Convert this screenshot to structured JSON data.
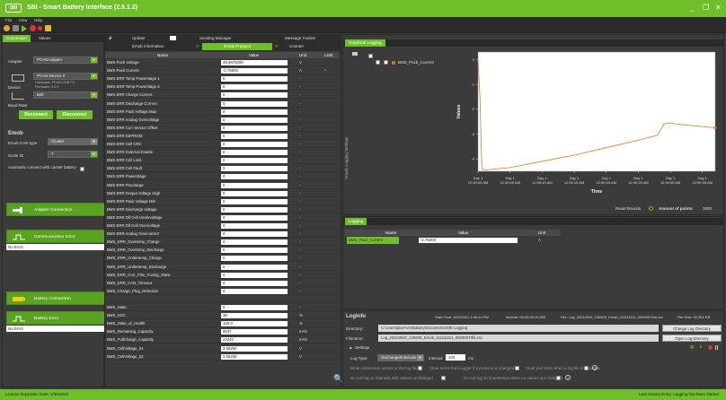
{
  "window": {
    "logo_text": "SBI",
    "title": "SBI - Smart Battery Interface (2.5.1.2)",
    "min": "_",
    "restore": "❐",
    "close": "✕"
  },
  "menu": [
    "File",
    "View",
    "Help"
  ],
  "left": {
    "tabs": [
      "Connection",
      "Values"
    ],
    "adapter_label": "Adapter",
    "adapter_value": "PCANAdapter",
    "device_label": "Device",
    "device_value": "PCAN Device 0",
    "hardware": "Hardware: PCAN-USB FD",
    "firmware": "Firmware: 3.2.0",
    "baud_label": "Baud Rate",
    "baud_value": "500",
    "reconnect": "Reconnect",
    "disconnect": "Disconnect",
    "emob_title": "Emob",
    "can_type_label": "Emob CAN type",
    "can_type_value": "Cluster",
    "scale_label": "Scale ID",
    "scale_value": "7",
    "auto_connect": "Automatic connect with cluster battery",
    "adapter_connection": "Adapter Connection",
    "comm_error": "Communication Error",
    "comm_error_value": "No Error",
    "battery_connection": "Battery Connection",
    "battery_error": "Battery Error",
    "battery_error_value": "No Error"
  },
  "middle": {
    "tabs_top": [
      "Update",
      "Emob Information",
      "Emob Protocol",
      "Sending Manager",
      "Message Tracker",
      "Counter"
    ],
    "columns": [
      "Name",
      "Value",
      "Unit",
      "Limit"
    ],
    "rows": [
      {
        "name": "BMS Pack Voltage",
        "value": "49.6875000",
        "unit": "V",
        "lim": ""
      },
      {
        "name": "BMS Pack Current",
        "value": "-2.75000",
        "unit": "A",
        "lim": "•"
      },
      {
        "name": "BMS ERR Temp Powerstage 1",
        "value": "0",
        "unit": "-",
        "lim": ""
      },
      {
        "name": "BMS ERR Temp Powerstage 2",
        "value": "0",
        "unit": "-",
        "lim": ""
      },
      {
        "name": "BMS ERR Charge Current",
        "value": "0",
        "unit": "-",
        "lim": ""
      },
      {
        "name": "BMS ERR Discharge Current",
        "value": "0",
        "unit": "-",
        "lim": ""
      },
      {
        "name": "BMS ERR Pack Voltage Max",
        "value": "0",
        "unit": "-",
        "lim": ""
      },
      {
        "name": "BMS ERR Analog Overvoltage",
        "value": "0",
        "unit": "-",
        "lim": ""
      },
      {
        "name": "BMS ERR Curr Sensor Offset",
        "value": "0",
        "unit": "-",
        "lim": ""
      },
      {
        "name": "BMS ERR EEPROM",
        "value": "0",
        "unit": "-",
        "lim": ""
      },
      {
        "name": "BMS ERR Cell CRC",
        "value": "0",
        "unit": "-",
        "lim": ""
      },
      {
        "name": "BMS ERR External Enable",
        "value": "0",
        "unit": "-",
        "lim": ""
      },
      {
        "name": "BMS ERR Cell Limit",
        "value": "0",
        "unit": "-",
        "lim": ""
      },
      {
        "name": "BMS ERR Cell Fault",
        "value": "0",
        "unit": "-",
        "lim": ""
      },
      {
        "name": "BMS ERR Powerstage",
        "value": "0",
        "unit": "-",
        "lim": ""
      },
      {
        "name": "BMS ERR Precharge",
        "value": "0",
        "unit": "-",
        "lim": ""
      },
      {
        "name": "BMS ERR Output Voltage High",
        "value": "0",
        "unit": "-",
        "lim": ""
      },
      {
        "name": "BMS ERR Pack Voltage Min",
        "value": "0",
        "unit": "-",
        "lim": ""
      },
      {
        "name": "BMS ERR Discharge Voltage",
        "value": "0",
        "unit": "-",
        "lim": ""
      },
      {
        "name": "BMS ERR Dif Cell Undervoltage",
        "value": "0",
        "unit": "-",
        "lim": ""
      },
      {
        "name": "BMS ERR Dif Cell Overvoltage",
        "value": "0",
        "unit": "-",
        "lim": ""
      },
      {
        "name": "BMS ERR Analog Overcurrent",
        "value": "0",
        "unit": "-",
        "lim": ""
      },
      {
        "name": "BMS_ERR_Overtemp_Charge",
        "value": "0",
        "unit": "-",
        "lim": ""
      },
      {
        "name": "BMS_ERR_Overtemp_Discharge",
        "value": "0",
        "unit": "-",
        "lim": ""
      },
      {
        "name": "BMS_ERR_Undertemp_Charge",
        "value": "0",
        "unit": "-",
        "lim": ""
      },
      {
        "name": "BMS_ERR_Undertemp_Discharge",
        "value": "0",
        "unit": "-",
        "lim": ""
      },
      {
        "name": "BMS_ERR_Curr_Plim_Fusing_Static",
        "value": "0",
        "unit": "-",
        "lim": ""
      },
      {
        "name": "BMS_ERR_CAN_Timeout",
        "value": "0",
        "unit": "-",
        "lim": ""
      },
      {
        "name": "BMS_Charge_Plug_Detection",
        "value": "0",
        "unit": "-",
        "lim": ""
      },
      {
        "name": "",
        "value": "",
        "unit": "",
        "lim": ""
      },
      {
        "name": "BMS_State",
        "value": "0",
        "unit": "-",
        "lim": ""
      },
      {
        "name": "BMS_SOC",
        "value": "38",
        "unit": "%",
        "lim": ""
      },
      {
        "name": "BMS_State_of_Health",
        "value": "100.0",
        "unit": "%",
        "lim": ""
      },
      {
        "name": "BMS_Remaining_Capacity",
        "value": "8537",
        "unit": "mAh",
        "lim": ""
      },
      {
        "name": "BMS_FullCharge_Capacity",
        "value": "22240",
        "unit": "mAh",
        "lim": ""
      },
      {
        "name": "BMS_CellVoltage_01",
        "value": "3.56250",
        "unit": "V",
        "lim": ""
      },
      {
        "name": "BMS_CellVoltage_02",
        "value": "3.56250",
        "unit": "V",
        "lim": ""
      }
    ]
  },
  "graph": {
    "tab": "Graphical Logging",
    "side_label": "Graph Logging Settings",
    "series_name": "BMS_Pack_Current",
    "ylabel": "Values",
    "xlabel": "Time",
    "y_ticks": [
      "0",
      "-1",
      "-2",
      "-3",
      "-4"
    ],
    "x_ticks": [
      [
        "Day 1",
        "12:00:00 AM"
      ],
      [
        "Day 1",
        "12:00:05 AM"
      ],
      [
        "Day 1",
        "12:00:10 AM"
      ],
      [
        "Day 1",
        "12:00:15 AM"
      ],
      [
        "Day 1",
        "12:00:20 AM"
      ],
      [
        "Day 1",
        "12:00:25 AM"
      ],
      [
        "Day 1",
        "12:00:30 AM"
      ],
      [
        "Day 1",
        "12:00:35 AM"
      ]
    ],
    "reset_bounds": "Reset Bounds",
    "amount_label": "Amount of points:",
    "amount_value": "3000",
    "line_color": "#e07a2a"
  },
  "chart_data": {
    "type": "line",
    "xlabel": "Time",
    "ylabel": "Values",
    "ylim": [
      -4.5,
      0.3
    ],
    "series": [
      {
        "name": "BMS_Pack_Current",
        "x_seconds": [
          0,
          0.3,
          0.6,
          1,
          5,
          10,
          15,
          20,
          25,
          28,
          29,
          30,
          31,
          33,
          35,
          37
        ],
        "values": [
          0,
          -1.5,
          -4.4,
          -4.45,
          -4.35,
          -4.1,
          -3.85,
          -3.55,
          -3.25,
          -3.05,
          -2.6,
          -2.55,
          -2.6,
          -2.65,
          -2.7,
          -2.75
        ]
      }
    ]
  },
  "logging": {
    "tab": "Logging",
    "columns": [
      "Name",
      "Value",
      "Unit"
    ],
    "row_name": "BMS_Pack_Current",
    "row_value": "-2.75000",
    "row_unit": "A"
  },
  "loginfo": {
    "title": "LogInfo",
    "start_time": "Start Time: 9/10/2021 1:06:14 PM",
    "interval": "Interval: 00:00:00:10.000",
    "file": "File: Log_20210910_130609_Emob_111111111_00000070fa.csv",
    "file_size": "File Size: 32,501 KB",
    "directory_label": "Directory:",
    "directory_value": "C:\\Users\\pixel-vm\\Battery\\Documents\\SBI Logging",
    "filename_label": "Filename:",
    "filename_value": "Log_20210910_130609_Emob_111111111_00000070fa.csv",
    "change_dir": "Change Log Directory",
    "open_dir": "Open Log Directory",
    "settings": "Settings",
    "log_type_label": "Log Type:",
    "log_type_value": "Onchange/Intervals",
    "interval_label": "Interval:",
    "interval_value": "100",
    "interval_unit": "ms",
    "opt1": "Write connection losses to the log file",
    "opt2": "Clear items from logger if a protocol is changed",
    "opt3": "Clear plot lines when a log file is changed",
    "opt4": "Do not log on intervals with values unchanged",
    "opt5": "Do not log on timestamps when no values are changed"
  },
  "status": {
    "license": "License Expiration Date: 1/30/2023",
    "last_entry": "Last History Entry: Logging has been started"
  }
}
